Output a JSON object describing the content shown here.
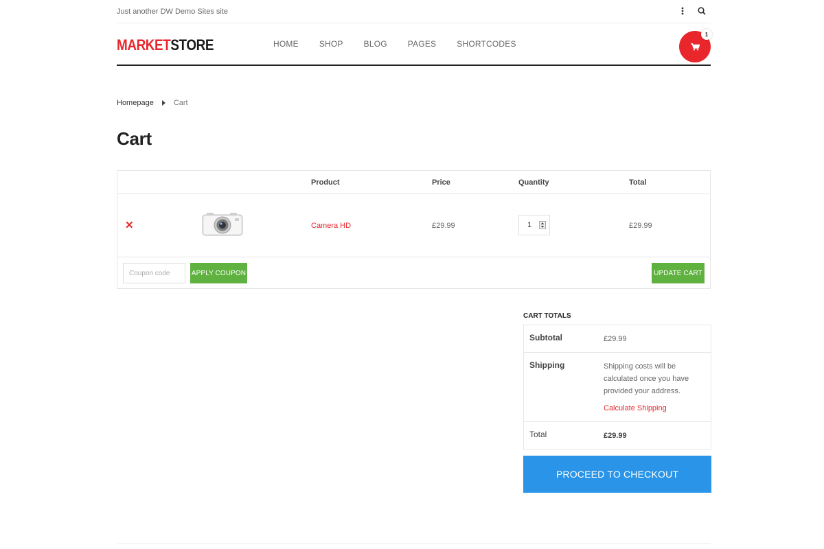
{
  "site": {
    "tagline": "Just another DW Demo Sites site",
    "logo_part1": "MARKET",
    "logo_part2": "STORE"
  },
  "nav": [
    "HOME",
    "SHOP",
    "BLOG",
    "PAGES",
    "SHORTCODES"
  ],
  "cart_badge": {
    "count": "1"
  },
  "breadcrumb": {
    "home": "Homepage",
    "current": "Cart"
  },
  "page": {
    "title": "Cart"
  },
  "table": {
    "headers": {
      "product": "Product",
      "price": "Price",
      "quantity": "Quantity",
      "total": "Total"
    },
    "rows": [
      {
        "name": "Camera HD",
        "price": "£29.99",
        "quantity": "1",
        "total": "£29.99"
      }
    ],
    "remove_icon": "✕"
  },
  "actions": {
    "coupon_placeholder": "Coupon code",
    "apply_coupon": "APPLY COUPON",
    "update_cart": "UPDATE CART"
  },
  "totals": {
    "title": "CART TOTALS",
    "subtotal_label": "Subtotal",
    "subtotal_value": "£29.99",
    "shipping_label": "Shipping",
    "shipping_text": "Shipping costs will be calculated once you have provided your address.",
    "calculate_shipping": "Calculate Shipping",
    "total_label": "Total",
    "total_value": "£29.99"
  },
  "checkout": {
    "label": "PROCEED TO CHECKOUT"
  },
  "colors": {
    "accent": "#e8262c",
    "green": "#5fb23f",
    "blue": "#2a94e8"
  },
  "icons": [
    "more-vertical-icon",
    "search-icon",
    "cart-icon",
    "caret-right-icon",
    "remove-icon",
    "camera-image",
    "spinner-icon"
  ]
}
